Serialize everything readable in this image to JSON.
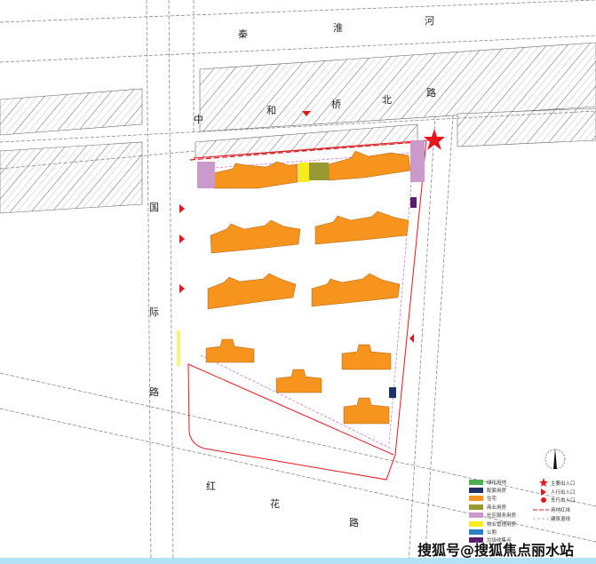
{
  "roads": {
    "north_river": [
      "秦",
      "淮",
      "河"
    ],
    "north_road": [
      "中",
      "和",
      "桥",
      "北",
      "路"
    ],
    "west_road": [
      "国",
      "际",
      "路"
    ],
    "south_road": [
      "红",
      "花",
      "路"
    ]
  },
  "legend": {
    "items": [
      {
        "color": "#4caf50",
        "label": "绿化用地"
      },
      {
        "color": "#1f3166",
        "label": "配套用房"
      },
      {
        "color": "#f7941d",
        "label": "住宅"
      },
      {
        "color": "#999933",
        "label": "商业用房"
      },
      {
        "color": "#cc99cc",
        "label": "社区服务用房"
      },
      {
        "color": "#f5eb1d",
        "label": "物业管理用房"
      },
      {
        "color": "#2e7fc1",
        "label": "公厕"
      },
      {
        "color": "#5a1f6a",
        "label": "垃圾收集点"
      }
    ],
    "symbols": [
      {
        "icon": "star-icon",
        "label": "主要出入口"
      },
      {
        "icon": "triangle-icon",
        "label": "人行出入口"
      },
      {
        "icon": "entrance-icon",
        "label": "车行出入口"
      },
      {
        "icon": "red-line-icon",
        "label": "用地红线"
      },
      {
        "icon": "setback-line-icon",
        "label": "建筑退线"
      }
    ]
  },
  "colors": {
    "building": "#f7941d",
    "boundary": "#e8141b",
    "community": "#cc99cc",
    "yellow": "#f5eb1d",
    "olive": "#999933"
  },
  "watermark": "搜狐号@搜狐焦点丽水站"
}
